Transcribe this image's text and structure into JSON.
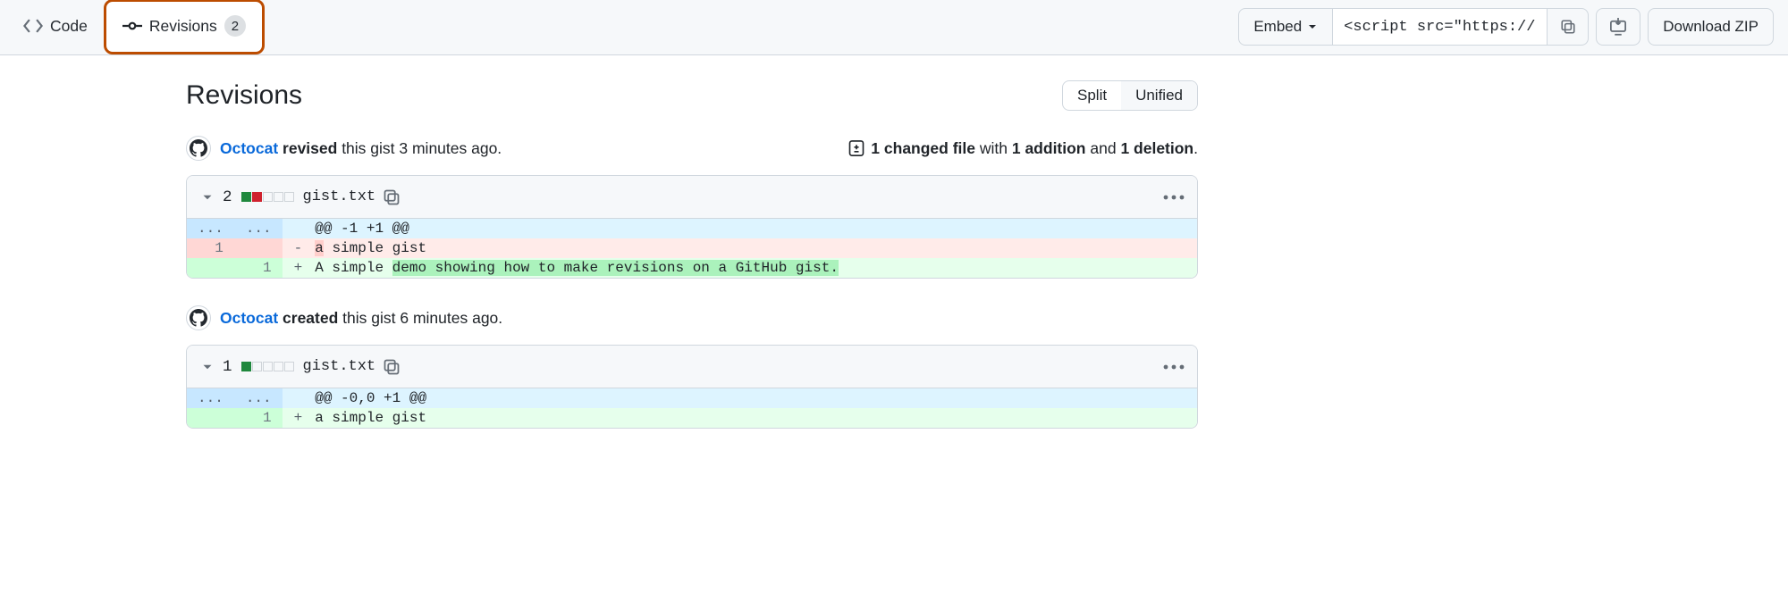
{
  "tabs": {
    "code": "Code",
    "revisions": "Revisions",
    "revisions_count": "2"
  },
  "toolbar": {
    "embed_label": "Embed",
    "embed_value": "<script src=\"https://",
    "download_label": "Download ZIP"
  },
  "heading": "Revisions",
  "diffmode": {
    "split": "Split",
    "unified": "Unified"
  },
  "revisions": [
    {
      "user": "Octocat",
      "action": "revised",
      "rest": " this gist 3 minutes ago.",
      "stats": {
        "files": "1 changed file",
        "with": " with ",
        "adds": "1 addition",
        "and": " and ",
        "dels": "1 deletion",
        "dot": "."
      },
      "file": {
        "changes": "2",
        "blocks": [
          "g",
          "r",
          "n",
          "n",
          "n"
        ],
        "name": "gist.txt",
        "rows": [
          {
            "type": "hunk",
            "l": "...",
            "r": "...",
            "text": "@@ -1 +1 @@"
          },
          {
            "type": "del",
            "l": "1",
            "r": "",
            "text": "a simple gist",
            "hl": "a"
          },
          {
            "type": "add",
            "l": "",
            "r": "1",
            "text": "A simple demo showing how to make revisions on a GitHub gist.",
            "hl": "demo showing how to make revisions on a GitHub gist."
          }
        ]
      }
    },
    {
      "user": "Octocat",
      "action": "created",
      "rest": " this gist 6 minutes ago.",
      "file": {
        "changes": "1",
        "blocks": [
          "g",
          "n",
          "n",
          "n",
          "n"
        ],
        "name": "gist.txt",
        "rows": [
          {
            "type": "hunk",
            "l": "...",
            "r": "...",
            "text": "@@ -0,0 +1 @@"
          },
          {
            "type": "add",
            "l": "",
            "r": "1",
            "text": "a simple gist"
          }
        ]
      }
    }
  ]
}
